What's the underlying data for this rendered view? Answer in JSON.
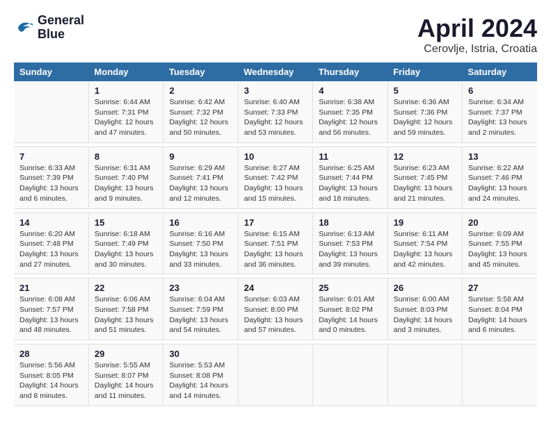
{
  "header": {
    "logo_line1": "General",
    "logo_line2": "Blue",
    "month_year": "April 2024",
    "location": "Cerovlje, Istria, Croatia"
  },
  "columns": [
    "Sunday",
    "Monday",
    "Tuesday",
    "Wednesday",
    "Thursday",
    "Friday",
    "Saturday"
  ],
  "weeks": [
    [
      {
        "day": "",
        "detail": ""
      },
      {
        "day": "1",
        "detail": "Sunrise: 6:44 AM\nSunset: 7:31 PM\nDaylight: 12 hours\nand 47 minutes."
      },
      {
        "day": "2",
        "detail": "Sunrise: 6:42 AM\nSunset: 7:32 PM\nDaylight: 12 hours\nand 50 minutes."
      },
      {
        "day": "3",
        "detail": "Sunrise: 6:40 AM\nSunset: 7:33 PM\nDaylight: 12 hours\nand 53 minutes."
      },
      {
        "day": "4",
        "detail": "Sunrise: 6:38 AM\nSunset: 7:35 PM\nDaylight: 12 hours\nand 56 minutes."
      },
      {
        "day": "5",
        "detail": "Sunrise: 6:36 AM\nSunset: 7:36 PM\nDaylight: 12 hours\nand 59 minutes."
      },
      {
        "day": "6",
        "detail": "Sunrise: 6:34 AM\nSunset: 7:37 PM\nDaylight: 13 hours\nand 2 minutes."
      }
    ],
    [
      {
        "day": "7",
        "detail": "Sunrise: 6:33 AM\nSunset: 7:39 PM\nDaylight: 13 hours\nand 6 minutes."
      },
      {
        "day": "8",
        "detail": "Sunrise: 6:31 AM\nSunset: 7:40 PM\nDaylight: 13 hours\nand 9 minutes."
      },
      {
        "day": "9",
        "detail": "Sunrise: 6:29 AM\nSunset: 7:41 PM\nDaylight: 13 hours\nand 12 minutes."
      },
      {
        "day": "10",
        "detail": "Sunrise: 6:27 AM\nSunset: 7:42 PM\nDaylight: 13 hours\nand 15 minutes."
      },
      {
        "day": "11",
        "detail": "Sunrise: 6:25 AM\nSunset: 7:44 PM\nDaylight: 13 hours\nand 18 minutes."
      },
      {
        "day": "12",
        "detail": "Sunrise: 6:23 AM\nSunset: 7:45 PM\nDaylight: 13 hours\nand 21 minutes."
      },
      {
        "day": "13",
        "detail": "Sunrise: 6:22 AM\nSunset: 7:46 PM\nDaylight: 13 hours\nand 24 minutes."
      }
    ],
    [
      {
        "day": "14",
        "detail": "Sunrise: 6:20 AM\nSunset: 7:48 PM\nDaylight: 13 hours\nand 27 minutes."
      },
      {
        "day": "15",
        "detail": "Sunrise: 6:18 AM\nSunset: 7:49 PM\nDaylight: 13 hours\nand 30 minutes."
      },
      {
        "day": "16",
        "detail": "Sunrise: 6:16 AM\nSunset: 7:50 PM\nDaylight: 13 hours\nand 33 minutes."
      },
      {
        "day": "17",
        "detail": "Sunrise: 6:15 AM\nSunset: 7:51 PM\nDaylight: 13 hours\nand 36 minutes."
      },
      {
        "day": "18",
        "detail": "Sunrise: 6:13 AM\nSunset: 7:53 PM\nDaylight: 13 hours\nand 39 minutes."
      },
      {
        "day": "19",
        "detail": "Sunrise: 6:11 AM\nSunset: 7:54 PM\nDaylight: 13 hours\nand 42 minutes."
      },
      {
        "day": "20",
        "detail": "Sunrise: 6:09 AM\nSunset: 7:55 PM\nDaylight: 13 hours\nand 45 minutes."
      }
    ],
    [
      {
        "day": "21",
        "detail": "Sunrise: 6:08 AM\nSunset: 7:57 PM\nDaylight: 13 hours\nand 48 minutes."
      },
      {
        "day": "22",
        "detail": "Sunrise: 6:06 AM\nSunset: 7:58 PM\nDaylight: 13 hours\nand 51 minutes."
      },
      {
        "day": "23",
        "detail": "Sunrise: 6:04 AM\nSunset: 7:59 PM\nDaylight: 13 hours\nand 54 minutes."
      },
      {
        "day": "24",
        "detail": "Sunrise: 6:03 AM\nSunset: 8:00 PM\nDaylight: 13 hours\nand 57 minutes."
      },
      {
        "day": "25",
        "detail": "Sunrise: 6:01 AM\nSunset: 8:02 PM\nDaylight: 14 hours\nand 0 minutes."
      },
      {
        "day": "26",
        "detail": "Sunrise: 6:00 AM\nSunset: 8:03 PM\nDaylight: 14 hours\nand 3 minutes."
      },
      {
        "day": "27",
        "detail": "Sunrise: 5:58 AM\nSunset: 8:04 PM\nDaylight: 14 hours\nand 6 minutes."
      }
    ],
    [
      {
        "day": "28",
        "detail": "Sunrise: 5:56 AM\nSunset: 8:05 PM\nDaylight: 14 hours\nand 8 minutes."
      },
      {
        "day": "29",
        "detail": "Sunrise: 5:55 AM\nSunset: 8:07 PM\nDaylight: 14 hours\nand 11 minutes."
      },
      {
        "day": "30",
        "detail": "Sunrise: 5:53 AM\nSunset: 8:08 PM\nDaylight: 14 hours\nand 14 minutes."
      },
      {
        "day": "",
        "detail": ""
      },
      {
        "day": "",
        "detail": ""
      },
      {
        "day": "",
        "detail": ""
      },
      {
        "day": "",
        "detail": ""
      }
    ]
  ]
}
